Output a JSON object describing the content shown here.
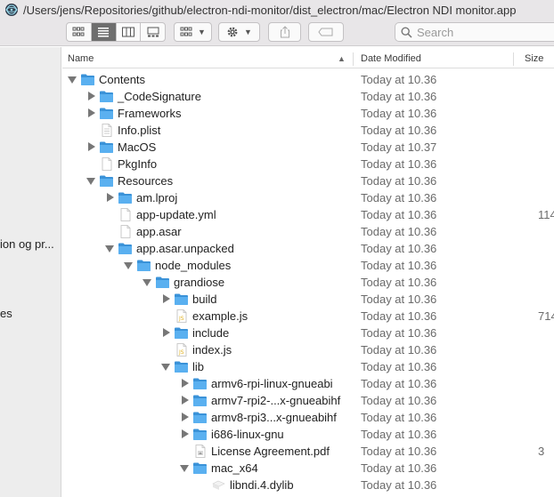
{
  "window": {
    "title": "/Users/jens/Repositories/github/electron-ndi-monitor/dist_electron/mac/Electron NDI monitor.app"
  },
  "toolbar": {
    "view_modes": [
      "icon-view",
      "list-view",
      "column-view",
      "gallery-view"
    ],
    "active_view": "list-view",
    "search_placeholder": "Search"
  },
  "sidebar": {
    "items": [
      {
        "label": "ion og pr..."
      },
      {
        "label": "es"
      }
    ]
  },
  "columns": {
    "name": "Name",
    "date_modified": "Date Modified",
    "size": "Size"
  },
  "colors": {
    "folder": "#5ab0f0",
    "folder_dark": "#3a92d8",
    "selected_view": "#6e6e6e",
    "toolbar_bg": "#e8e6e8"
  },
  "rows": [
    {
      "name": "Contents",
      "date": "Today at 10.36",
      "size": "",
      "icon": "folder-icon",
      "expander": "open",
      "depth": 0
    },
    {
      "name": "_CodeSignature",
      "date": "Today at 10.36",
      "size": "",
      "icon": "folder-icon",
      "expander": "closed",
      "depth": 1
    },
    {
      "name": "Frameworks",
      "date": "Today at 10.36",
      "size": "",
      "icon": "folder-icon",
      "expander": "closed",
      "depth": 1
    },
    {
      "name": "Info.plist",
      "date": "Today at 10.36",
      "size": "",
      "icon": "plist-file-icon",
      "expander": "none",
      "depth": 1
    },
    {
      "name": "MacOS",
      "date": "Today at 10.37",
      "size": "",
      "icon": "folder-icon",
      "expander": "closed",
      "depth": 1
    },
    {
      "name": "PkgInfo",
      "date": "Today at 10.36",
      "size": "",
      "icon": "blank-file-icon",
      "expander": "none",
      "depth": 1
    },
    {
      "name": "Resources",
      "date": "Today at 10.36",
      "size": "",
      "icon": "folder-icon",
      "expander": "open",
      "depth": 1
    },
    {
      "name": "am.lproj",
      "date": "Today at 10.36",
      "size": "",
      "icon": "folder-icon",
      "expander": "closed",
      "depth": 2
    },
    {
      "name": "app-update.yml",
      "date": "Today at 10.36",
      "size": "114",
      "icon": "blank-file-icon",
      "expander": "none",
      "depth": 2
    },
    {
      "name": "app.asar",
      "date": "Today at 10.36",
      "size": "",
      "icon": "blank-file-icon",
      "expander": "none",
      "depth": 2
    },
    {
      "name": "app.asar.unpacked",
      "date": "Today at 10.36",
      "size": "",
      "icon": "folder-icon",
      "expander": "open",
      "depth": 2
    },
    {
      "name": "node_modules",
      "date": "Today at 10.36",
      "size": "",
      "icon": "folder-icon",
      "expander": "open",
      "depth": 3
    },
    {
      "name": "grandiose",
      "date": "Today at 10.36",
      "size": "",
      "icon": "folder-icon",
      "expander": "open",
      "depth": 4
    },
    {
      "name": "build",
      "date": "Today at 10.36",
      "size": "",
      "icon": "folder-icon",
      "expander": "closed",
      "depth": 5
    },
    {
      "name": "example.js",
      "date": "Today at 10.36",
      "size": "714",
      "icon": "js-file-icon",
      "expander": "none",
      "depth": 5
    },
    {
      "name": "include",
      "date": "Today at 10.36",
      "size": "",
      "icon": "folder-icon",
      "expander": "closed",
      "depth": 5
    },
    {
      "name": "index.js",
      "date": "Today at 10.36",
      "size": "",
      "icon": "js-file-icon",
      "expander": "none",
      "depth": 5
    },
    {
      "name": "lib",
      "date": "Today at 10.36",
      "size": "",
      "icon": "folder-icon",
      "expander": "open",
      "depth": 5
    },
    {
      "name": "armv6-rpi-linux-gnueabi",
      "date": "Today at 10.36",
      "size": "",
      "icon": "folder-icon",
      "expander": "closed",
      "depth": 6
    },
    {
      "name": "armv7-rpi2-...x-gnueabihf",
      "date": "Today at 10.36",
      "size": "",
      "icon": "folder-icon",
      "expander": "closed",
      "depth": 6
    },
    {
      "name": "armv8-rpi3...x-gnueabihf",
      "date": "Today at 10.36",
      "size": "",
      "icon": "folder-icon",
      "expander": "closed",
      "depth": 6
    },
    {
      "name": "i686-linux-gnu",
      "date": "Today at 10.36",
      "size": "",
      "icon": "folder-icon",
      "expander": "closed",
      "depth": 6
    },
    {
      "name": "License Agreement.pdf",
      "date": "Today at 10.36",
      "size": "3",
      "icon": "pdf-file-icon",
      "expander": "none",
      "depth": 6
    },
    {
      "name": "mac_x64",
      "date": "Today at 10.36",
      "size": "",
      "icon": "folder-icon",
      "expander": "open",
      "depth": 6
    },
    {
      "name": "libndi.4.dylib",
      "date": "Today at 10.36",
      "size": "",
      "icon": "exec-file-icon",
      "expander": "none",
      "depth": 7
    }
  ]
}
